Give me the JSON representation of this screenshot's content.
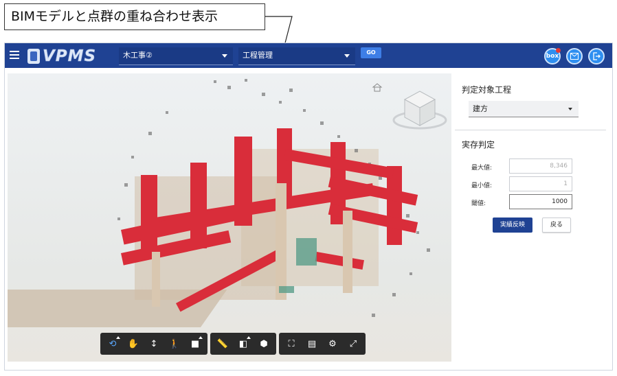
{
  "annotation": {
    "caption": "BIMモデルと点群の重ね合わせ表示"
  },
  "header": {
    "logo_text": "VPMS",
    "project_select": "木工事②",
    "process_select": "工程管理",
    "go_label": "GO",
    "box_label": "box"
  },
  "panel": {
    "target_process_title": "判定対象工程",
    "target_process_value": "建方",
    "judgement_title": "実存判定",
    "max_label": "最大値:",
    "max_value": "8,346",
    "min_label": "最小値:",
    "min_value": "1",
    "threshold_label": "閾値:",
    "threshold_value": "1000",
    "apply_label": "実績反映",
    "back_label": "戻る"
  },
  "colors": {
    "header": "#1f4293",
    "bim_red": "#d92d3a",
    "accent_blue": "#2f8ff0"
  },
  "toolbar": {
    "icons": [
      "orbit-icon",
      "pan-icon",
      "zoom-icon",
      "walk-icon",
      "camera-icon",
      "measure-icon",
      "section-icon",
      "explode-icon",
      "model-browser-icon",
      "properties-icon",
      "settings-icon",
      "fullscreen-icon"
    ]
  }
}
